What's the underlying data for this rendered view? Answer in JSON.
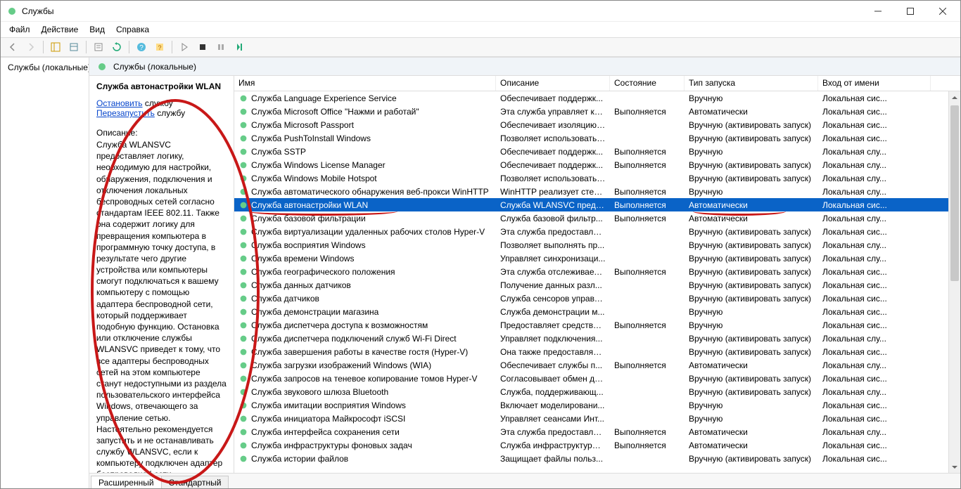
{
  "window": {
    "title": "Службы"
  },
  "menu": {
    "file": "Файл",
    "action": "Действие",
    "view": "Вид",
    "help": "Справка"
  },
  "tree": {
    "root": "Службы (локальные)"
  },
  "rightHead": "Службы (локальные)",
  "detail": {
    "title": "Служба автонастройки WLAN",
    "stop_pre": "Остановить",
    "stop_post": " службу",
    "restart_pre": "Перезапустить",
    "restart_post": " службу",
    "desc_label": "Описание:",
    "desc": "Служба WLANSVC предоставляет логику, необходимую для настройки, обнаружения, подключения и отключения локальных беспроводных сетей согласно стандартам IEEE 802.11. Также она содержит логику для превращения компьютера в программную точку доступа, в результате чего другие устройства или компьютеры смогут подключаться к вашему компьютеру с помощью адаптера беспроводной сети, который поддерживает подобную функцию. Остановка или отключение службы WLANSVC приведет к тому, что все адаптеры беспроводных сетей на этом компьютере станут недоступными из раздела пользовательского интерфейса Windows, отвечающего за управление сетью. Настоятельно рекомендуется запустить и не останавливать службу WLANSVC, если к компьютеру подключен адаптер беспроводной сети."
  },
  "columns": {
    "name": "Имя",
    "desc": "Описание",
    "state": "Состояние",
    "start": "Тип запуска",
    "logon": "Вход от имени"
  },
  "tabs": {
    "ext": "Расширенный",
    "std": "Стандартный"
  },
  "rows": [
    {
      "n": "Служба Language Experience Service",
      "d": "Обеспечивает поддержк...",
      "s": "",
      "t": "Вручную",
      "l": "Локальная сис..."
    },
    {
      "n": "Служба Microsoft Office \"Нажми и работай\"",
      "d": "Эта служба управляет ко...",
      "s": "Выполняется",
      "t": "Автоматически",
      "l": "Локальная сис..."
    },
    {
      "n": "Служба Microsoft Passport",
      "d": "Обеспечивает изоляцию ...",
      "s": "",
      "t": "Вручную (активировать запуск)",
      "l": "Локальная сис..."
    },
    {
      "n": "Служба PushToInstall Windows",
      "d": "Позволяет использовать ...",
      "s": "",
      "t": "Вручную (активировать запуск)",
      "l": "Локальная сис..."
    },
    {
      "n": "Служба SSTP",
      "d": "Обеспечивает поддержк...",
      "s": "Выполняется",
      "t": "Вручную",
      "l": "Локальная слу..."
    },
    {
      "n": "Служба Windows License Manager",
      "d": "Обеспечивает поддержк...",
      "s": "Выполняется",
      "t": "Вручную (активировать запуск)",
      "l": "Локальная слу..."
    },
    {
      "n": "Служба Windows Mobile Hotspot",
      "d": "Позволяет использовать ...",
      "s": "",
      "t": "Вручную (активировать запуск)",
      "l": "Локальная слу..."
    },
    {
      "n": "Служба автоматического обнаружения веб-прокси WinHTTP",
      "d": "WinHTTP реализует стек ...",
      "s": "Выполняется",
      "t": "Вручную",
      "l": "Локальная слу..."
    },
    {
      "n": "Служба автонастройки WLAN",
      "d": "Служба WLANSVC предо...",
      "s": "Выполняется",
      "t": "Автоматически",
      "l": "Локальная сис...",
      "sel": true
    },
    {
      "n": "Служба базовой фильтрации",
      "d": "Служба базовой фильтр...",
      "s": "Выполняется",
      "t": "Автоматически",
      "l": "Локальная слу..."
    },
    {
      "n": "Служба виртуализации удаленных рабочих столов Hyper-V",
      "d": "Эта служба предоставляе...",
      "s": "",
      "t": "Вручную (активировать запуск)",
      "l": "Локальная сис..."
    },
    {
      "n": "Служба восприятия Windows",
      "d": "Позволяет выполнять пр...",
      "s": "",
      "t": "Вручную (активировать запуск)",
      "l": "Локальная слу..."
    },
    {
      "n": "Служба времени Windows",
      "d": "Управляет синхронизаци...",
      "s": "",
      "t": "Вручную (активировать запуск)",
      "l": "Локальная слу..."
    },
    {
      "n": "Служба географического положения",
      "d": "Эта служба отслеживает ...",
      "s": "Выполняется",
      "t": "Вручную (активировать запуск)",
      "l": "Локальная сис..."
    },
    {
      "n": "Служба данных датчиков",
      "d": "Получение данных разл...",
      "s": "",
      "t": "Вручную (активировать запуск)",
      "l": "Локальная сис..."
    },
    {
      "n": "Служба датчиков",
      "d": "Служба сенсоров управл...",
      "s": "",
      "t": "Вручную (активировать запуск)",
      "l": "Локальная сис..."
    },
    {
      "n": "Служба демонстрации магазина",
      "d": "Служба демонстрации м...",
      "s": "",
      "t": "Вручную",
      "l": "Локальная сис..."
    },
    {
      "n": "Служба диспетчера доступа к возможностям",
      "d": "Предоставляет средства ...",
      "s": "Выполняется",
      "t": "Вручную",
      "l": "Локальная сис..."
    },
    {
      "n": "Служба диспетчера подключений служб Wi-Fi Direct",
      "d": "Управляет подключения...",
      "s": "",
      "t": "Вручную (активировать запуск)",
      "l": "Локальная слу..."
    },
    {
      "n": "Служба завершения работы в качестве гостя (Hyper-V)",
      "d": "Она также предоставляет...",
      "s": "",
      "t": "Вручную (активировать запуск)",
      "l": "Локальная сис..."
    },
    {
      "n": "Служба загрузки изображений Windows (WIA)",
      "d": "Обеспечивает службы п...",
      "s": "Выполняется",
      "t": "Автоматически",
      "l": "Локальная слу..."
    },
    {
      "n": "Служба запросов на теневое копирование томов Hyper-V",
      "d": "Согласовывает обмен да...",
      "s": "",
      "t": "Вручную (активировать запуск)",
      "l": "Локальная сис..."
    },
    {
      "n": "Служба звукового шлюза Bluetooth",
      "d": "Служба, поддерживающ...",
      "s": "",
      "t": "Вручную (активировать запуск)",
      "l": "Локальная слу..."
    },
    {
      "n": "Служба имитации восприятия Windows",
      "d": "Включает моделировани...",
      "s": "",
      "t": "Вручную",
      "l": "Локальная сис..."
    },
    {
      "n": "Служба инициатора Майкрософт iSCSI",
      "d": "Управляет сеансами Инт...",
      "s": "",
      "t": "Вручную",
      "l": "Локальная сис..."
    },
    {
      "n": "Служба интерфейса сохранения сети",
      "d": "Эта служба предоставляе...",
      "s": "Выполняется",
      "t": "Автоматически",
      "l": "Локальная слу..."
    },
    {
      "n": "Служба инфраструктуры фоновых задач",
      "d": "Служба инфраструктуры ...",
      "s": "Выполняется",
      "t": "Автоматически",
      "l": "Локальная сис..."
    },
    {
      "n": "Служба истории файлов",
      "d": "Защищает файлы польз...",
      "s": "",
      "t": "Вручную (активировать запуск)",
      "l": "Локальная сис..."
    }
  ]
}
